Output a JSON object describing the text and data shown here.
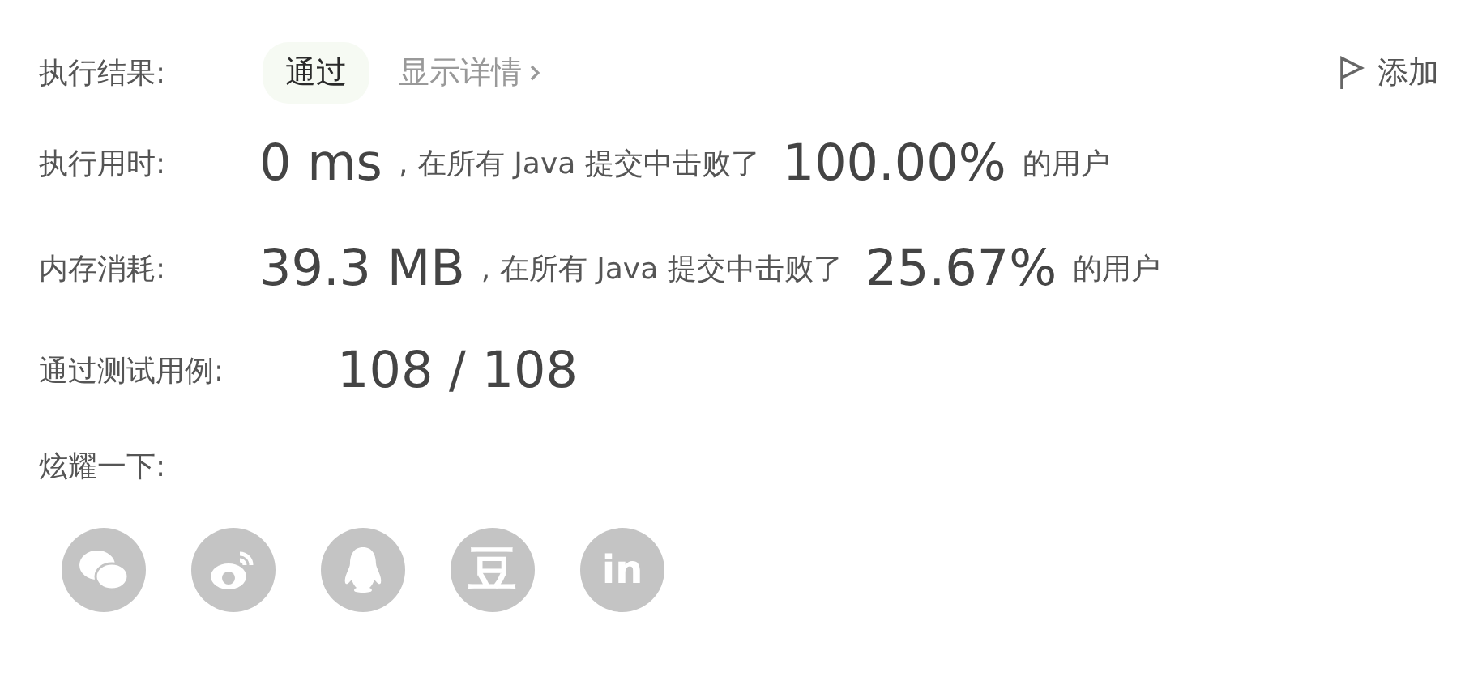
{
  "result": {
    "label": "执行结果:",
    "status": "通过",
    "details_link": "显示详情",
    "add_button": "添加"
  },
  "stats": [
    {
      "label": "执行用时:",
      "value": "0 ms",
      "middle": ", 在所有 Java 提交中击败了",
      "percent": "100.00%",
      "suffix": "的用户"
    },
    {
      "label": "内存消耗:",
      "value": "39.3 MB",
      "middle": ", 在所有 Java 提交中击败了",
      "percent": "25.67%",
      "suffix": "的用户"
    }
  ],
  "test_cases": {
    "label": "通过测试用例:",
    "value": "108 / 108"
  },
  "share": {
    "label": "炫耀一下:",
    "buttons": [
      {
        "kind": "wechat"
      },
      {
        "kind": "weibo"
      },
      {
        "kind": "qq"
      },
      {
        "kind": "douban",
        "text": "豆"
      },
      {
        "kind": "linkedin",
        "text": "in"
      }
    ]
  }
}
